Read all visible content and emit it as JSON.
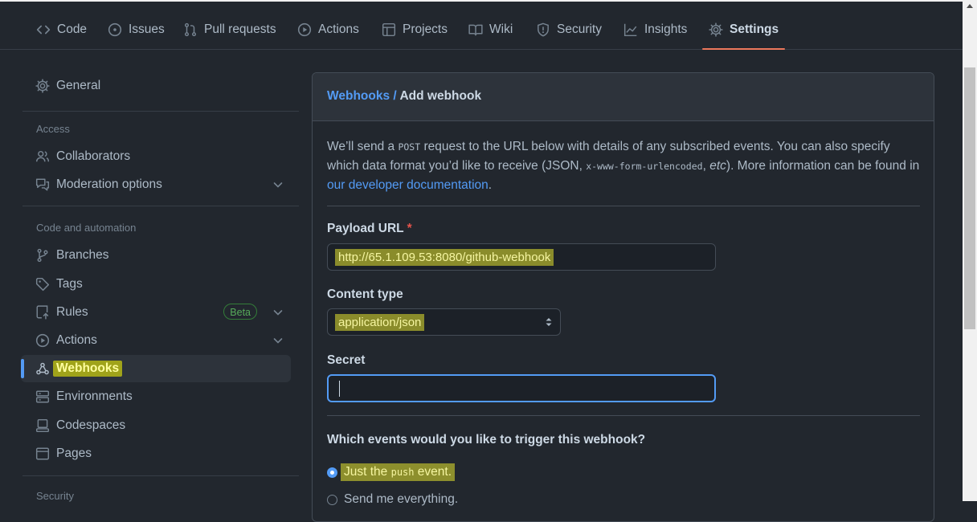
{
  "tabs": [
    {
      "label": "Code",
      "icon": "code-icon"
    },
    {
      "label": "Issues",
      "icon": "issue-opened-icon"
    },
    {
      "label": "Pull requests",
      "icon": "git-pull-request-icon"
    },
    {
      "label": "Actions",
      "icon": "play-icon"
    },
    {
      "label": "Projects",
      "icon": "table-icon"
    },
    {
      "label": "Wiki",
      "icon": "book-icon"
    },
    {
      "label": "Security",
      "icon": "shield-icon"
    },
    {
      "label": "Insights",
      "icon": "graph-icon"
    },
    {
      "label": "Settings",
      "icon": "gear-icon",
      "active": true
    }
  ],
  "sidebar": {
    "general": "General",
    "access_title": "Access",
    "collaborators": "Collaborators",
    "moderation": "Moderation options",
    "code_automation_title": "Code and automation",
    "branches": "Branches",
    "tags": "Tags",
    "rules": "Rules",
    "rules_badge": "Beta",
    "actions": "Actions",
    "webhooks": "Webhooks",
    "environments": "Environments",
    "codespaces": "Codespaces",
    "pages": "Pages",
    "security_title": "Security"
  },
  "main": {
    "breadcrumb_link": "Webhooks",
    "breadcrumb_sep": " / ",
    "breadcrumb_current": "Add webhook",
    "intro_1": "We’ll send a ",
    "intro_post": "POST",
    "intro_2": " request to the URL below with details of any subscribed events. You can also specify which data format you’d like to receive (JSON, ",
    "intro_format": "x-www-form-urlencoded",
    "intro_3": ", ",
    "intro_etc": "etc",
    "intro_4": "). More information can be found in ",
    "intro_link": "our developer documentation",
    "intro_5": ".",
    "payload_label": "Payload URL",
    "required_mark": "*",
    "payload_value": "http://65.1.109.53:8080/github-webhook",
    "content_type_label": "Content type",
    "content_type_value": "application/json",
    "secret_label": "Secret",
    "secret_value": "",
    "events_question": "Which events would you like to trigger this webhook?",
    "radio_push_1": "Just the ",
    "radio_push_code": "push",
    "radio_push_2": " event.",
    "radio_everything": "Send me everything."
  },
  "colors": {
    "accent": "#539bf5",
    "active_tab_underline": "#ec775c",
    "highlight": "#e5e52d"
  }
}
